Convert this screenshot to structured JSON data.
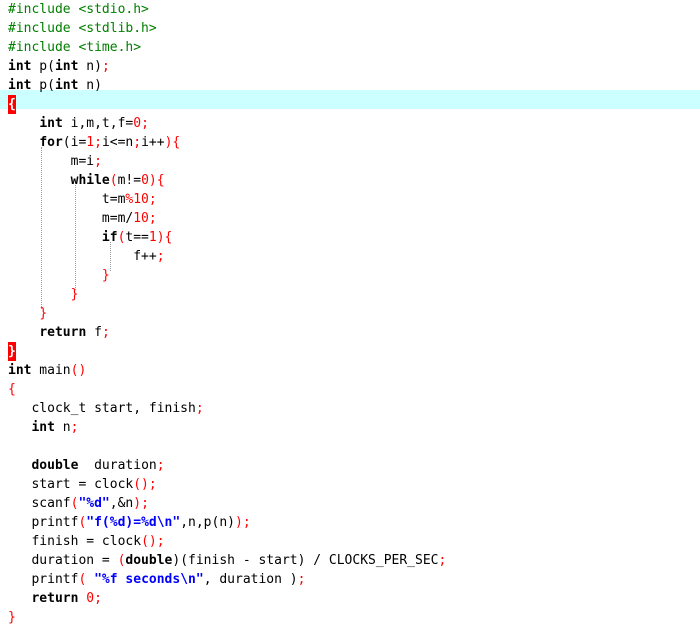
{
  "editor": {
    "lines": [
      {
        "tokens": [
          {
            "t": "#include <stdio.h>",
            "c": "pp"
          }
        ]
      },
      {
        "tokens": [
          {
            "t": "#include <stdlib.h>",
            "c": "pp"
          }
        ]
      },
      {
        "tokens": [
          {
            "t": "#include <time.h>",
            "c": "pp"
          }
        ]
      },
      {
        "tokens": [
          {
            "t": "int",
            "c": "kw"
          },
          {
            "t": " p(",
            "c": "plain"
          },
          {
            "t": "int",
            "c": "kw"
          },
          {
            "t": " n)",
            "c": "plain"
          },
          {
            "t": ";",
            "c": "op"
          }
        ]
      },
      {
        "tokens": [
          {
            "t": "int",
            "c": "kw"
          },
          {
            "t": " p(",
            "c": "plain"
          },
          {
            "t": "int",
            "c": "kw"
          },
          {
            "t": " n)",
            "c": "plain"
          }
        ]
      },
      {
        "tokens": [
          {
            "t": "{",
            "c": "brace-mark"
          }
        ]
      },
      {
        "tokens": [
          {
            "t": "    ",
            "c": "plain"
          },
          {
            "t": "int",
            "c": "kw"
          },
          {
            "t": " i,m,t,f=",
            "c": "plain"
          },
          {
            "t": "0",
            "c": "num"
          },
          {
            "t": ";",
            "c": "op"
          }
        ]
      },
      {
        "tokens": [
          {
            "t": "    ",
            "c": "plain"
          },
          {
            "t": "for",
            "c": "kw"
          },
          {
            "t": "(i=",
            "c": "plain"
          },
          {
            "t": "1",
            "c": "num"
          },
          {
            "t": ";",
            "c": "op"
          },
          {
            "t": "i<=n",
            "c": "plain"
          },
          {
            "t": ";",
            "c": "op"
          },
          {
            "t": "i++",
            "c": "plain"
          },
          {
            "t": "){",
            "c": "op"
          }
        ]
      },
      {
        "tokens": [
          {
            "t": "        m=i",
            "c": "plain"
          },
          {
            "t": ";",
            "c": "op"
          }
        ]
      },
      {
        "tokens": [
          {
            "t": "        ",
            "c": "plain"
          },
          {
            "t": "while",
            "c": "kw"
          },
          {
            "t": "(",
            "c": "op"
          },
          {
            "t": "m!=",
            "c": "plain"
          },
          {
            "t": "0",
            "c": "num"
          },
          {
            "t": "){",
            "c": "op"
          }
        ]
      },
      {
        "tokens": [
          {
            "t": "            t=m",
            "c": "plain"
          },
          {
            "t": "%",
            "c": "op"
          },
          {
            "t": "10",
            "c": "num"
          },
          {
            "t": ";",
            "c": "op"
          }
        ]
      },
      {
        "tokens": [
          {
            "t": "            m=m/",
            "c": "plain"
          },
          {
            "t": "10",
            "c": "num"
          },
          {
            "t": ";",
            "c": "op"
          }
        ]
      },
      {
        "tokens": [
          {
            "t": "            ",
            "c": "plain"
          },
          {
            "t": "if",
            "c": "kw"
          },
          {
            "t": "(",
            "c": "op"
          },
          {
            "t": "t==",
            "c": "plain"
          },
          {
            "t": "1",
            "c": "num"
          },
          {
            "t": "){",
            "c": "op"
          }
        ]
      },
      {
        "tokens": [
          {
            "t": "                f++",
            "c": "plain"
          },
          {
            "t": ";",
            "c": "op"
          }
        ]
      },
      {
        "tokens": [
          {
            "t": "            ",
            "c": "plain"
          },
          {
            "t": "}",
            "c": "op"
          }
        ]
      },
      {
        "tokens": [
          {
            "t": "        ",
            "c": "plain"
          },
          {
            "t": "}",
            "c": "op"
          }
        ]
      },
      {
        "tokens": [
          {
            "t": "    ",
            "c": "plain"
          },
          {
            "t": "}",
            "c": "op"
          }
        ]
      },
      {
        "tokens": [
          {
            "t": "    ",
            "c": "plain"
          },
          {
            "t": "return",
            "c": "kw"
          },
          {
            "t": " f",
            "c": "plain"
          },
          {
            "t": ";",
            "c": "op"
          }
        ]
      },
      {
        "tokens": [
          {
            "t": "}",
            "c": "brace-mark"
          }
        ]
      },
      {
        "tokens": [
          {
            "t": "int",
            "c": "kw"
          },
          {
            "t": " main",
            "c": "plain"
          },
          {
            "t": "()",
            "c": "op"
          }
        ]
      },
      {
        "tokens": [
          {
            "t": "{",
            "c": "op"
          }
        ]
      },
      {
        "tokens": [
          {
            "t": "   clock_t start, finish",
            "c": "plain"
          },
          {
            "t": ";",
            "c": "op"
          }
        ]
      },
      {
        "tokens": [
          {
            "t": "   ",
            "c": "plain"
          },
          {
            "t": "int",
            "c": "kw"
          },
          {
            "t": " n",
            "c": "plain"
          },
          {
            "t": ";",
            "c": "op"
          }
        ]
      },
      {
        "tokens": [
          {
            "t": "",
            "c": "plain"
          }
        ]
      },
      {
        "tokens": [
          {
            "t": "   ",
            "c": "plain"
          },
          {
            "t": "double",
            "c": "kw"
          },
          {
            "t": "  duration",
            "c": "plain"
          },
          {
            "t": ";",
            "c": "op"
          }
        ]
      },
      {
        "tokens": [
          {
            "t": "   start = clock",
            "c": "plain"
          },
          {
            "t": "();",
            "c": "op"
          }
        ]
      },
      {
        "tokens": [
          {
            "t": "   scanf",
            "c": "plain"
          },
          {
            "t": "(",
            "c": "op"
          },
          {
            "t": "\"%d\"",
            "c": "str"
          },
          {
            "t": ",&n",
            "c": "plain"
          },
          {
            "t": ");",
            "c": "op"
          }
        ]
      },
      {
        "tokens": [
          {
            "t": "   printf",
            "c": "plain"
          },
          {
            "t": "(",
            "c": "op"
          },
          {
            "t": "\"f(%d)=%d\\n\"",
            "c": "str"
          },
          {
            "t": ",n,p(n)",
            "c": "plain"
          },
          {
            "t": ");",
            "c": "op"
          }
        ]
      },
      {
        "tokens": [
          {
            "t": "   finish = clock",
            "c": "plain"
          },
          {
            "t": "();",
            "c": "op"
          }
        ]
      },
      {
        "tokens": [
          {
            "t": "   duration = ",
            "c": "plain"
          },
          {
            "t": "(",
            "c": "op"
          },
          {
            "t": "double",
            "c": "kw"
          },
          {
            "t": ")(finish - start) / CLOCKS_PER_SEC",
            "c": "plain"
          },
          {
            "t": ";",
            "c": "op"
          }
        ]
      },
      {
        "tokens": [
          {
            "t": "   printf",
            "c": "plain"
          },
          {
            "t": "( ",
            "c": "op"
          },
          {
            "t": "\"%f seconds\\n\"",
            "c": "str"
          },
          {
            "t": ", duration )",
            "c": "plain"
          },
          {
            "t": ";",
            "c": "op"
          }
        ]
      },
      {
        "tokens": [
          {
            "t": "   ",
            "c": "plain"
          },
          {
            "t": "return",
            "c": "kw"
          },
          {
            "t": " ",
            "c": "plain"
          },
          {
            "t": "0",
            "c": "num"
          },
          {
            "t": ";",
            "c": "op"
          }
        ]
      },
      {
        "tokens": [
          {
            "t": "}",
            "c": "op"
          }
        ]
      }
    ],
    "current_line_index": 5,
    "colors": {
      "preprocessor": "#008000",
      "keyword": "#000000",
      "operator": "#ff0000",
      "number": "#ff0000",
      "string": "#0000ff",
      "current_line_bg": "#ccffff",
      "brace_match_bg": "#ff0000"
    }
  }
}
